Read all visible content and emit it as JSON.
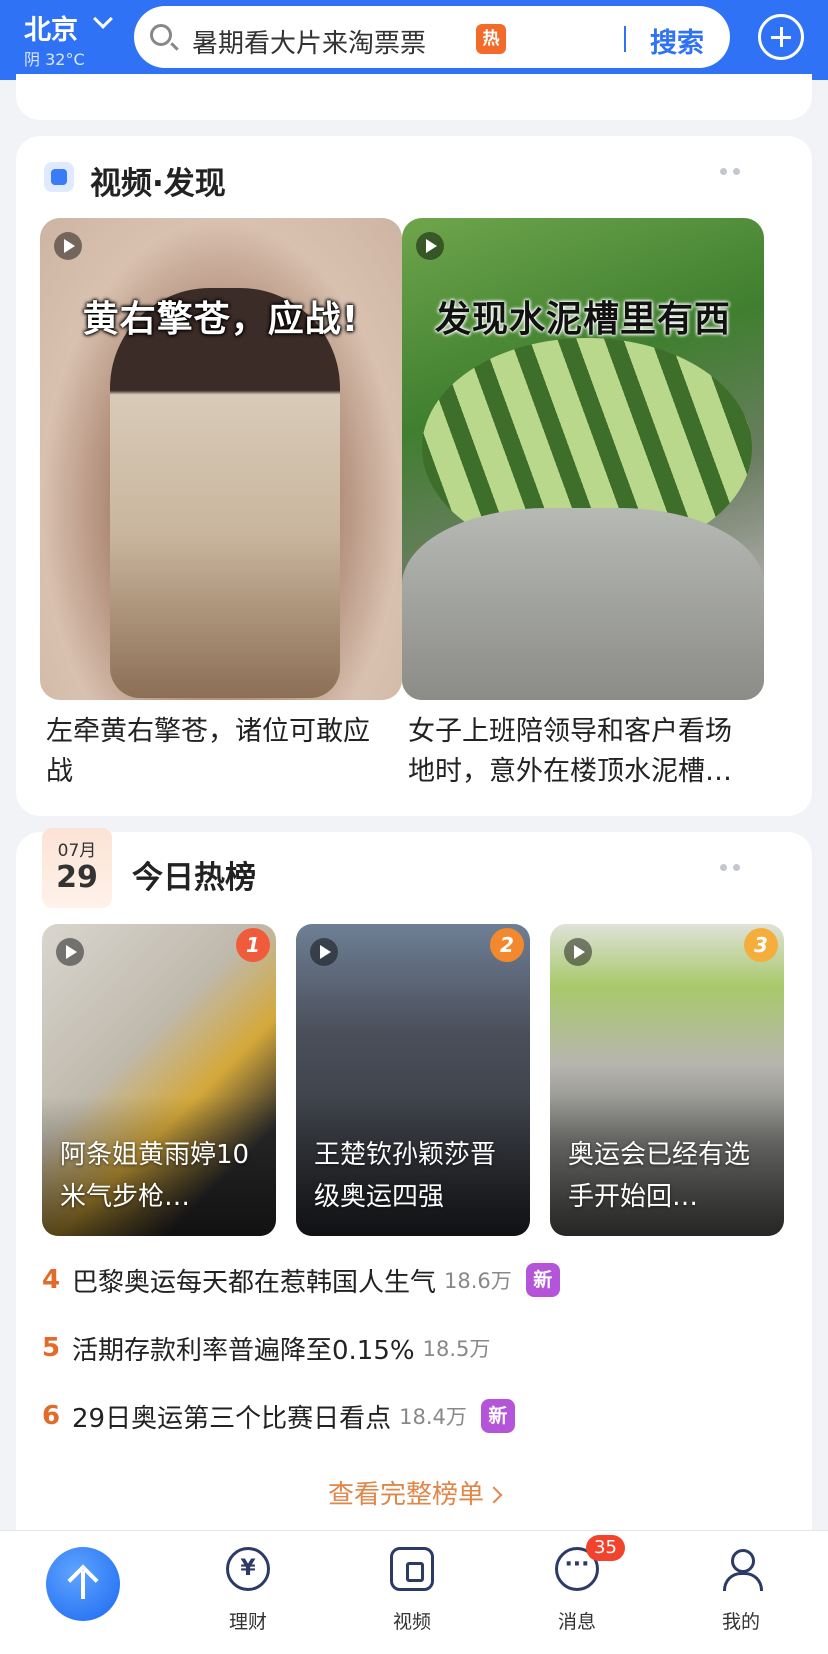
{
  "header": {
    "city": "北京",
    "weather": "阴 32°C",
    "search_text": "暑期看大片来淘票票",
    "hot_badge": "热",
    "search_button": "搜索",
    "brand_color": "#2f72f6"
  },
  "video_section": {
    "title": "视频·发现",
    "items": [
      {
        "overlay": "黄右擎苍，应战!",
        "title": "左牵黄右擎苍，诸位可敢应战"
      },
      {
        "overlay": "发现水泥槽里有西",
        "title": "女子上班陪领导和客户看场地时，意外在楼顶水泥槽…"
      }
    ]
  },
  "hot_section": {
    "date_month": "07月",
    "date_day": "29",
    "title": "今日热榜",
    "top_items": [
      {
        "rank": "1",
        "caption": "阿条姐黄雨婷10米气步枪…",
        "rank_color": "#f05b3b"
      },
      {
        "rank": "2",
        "caption": "王楚钦孙颖莎晋级奥运四强",
        "rank_color": "#f3892e"
      },
      {
        "rank": "3",
        "caption": "奥运会已经有选手开始回…",
        "rank_color": "#f5ae3c"
      }
    ],
    "list": [
      {
        "num": "4",
        "title": "巴黎奥运每天都在惹韩国人生气",
        "count": "18.6万",
        "badge": "新"
      },
      {
        "num": "5",
        "title": "活期存款利率普遍降至0.15%",
        "count": "18.5万",
        "badge": ""
      },
      {
        "num": "6",
        "title": "29日奥运第三个比赛日看点",
        "count": "18.4万",
        "badge": "新"
      }
    ],
    "more_label": "查看完整榜单"
  },
  "nav": {
    "tabs": [
      {
        "label": "理财",
        "icon": "yen-icon"
      },
      {
        "label": "视频",
        "icon": "video-icon"
      },
      {
        "label": "消息",
        "icon": "message-icon",
        "badge": "35"
      },
      {
        "label": "我的",
        "icon": "profile-icon"
      }
    ]
  }
}
